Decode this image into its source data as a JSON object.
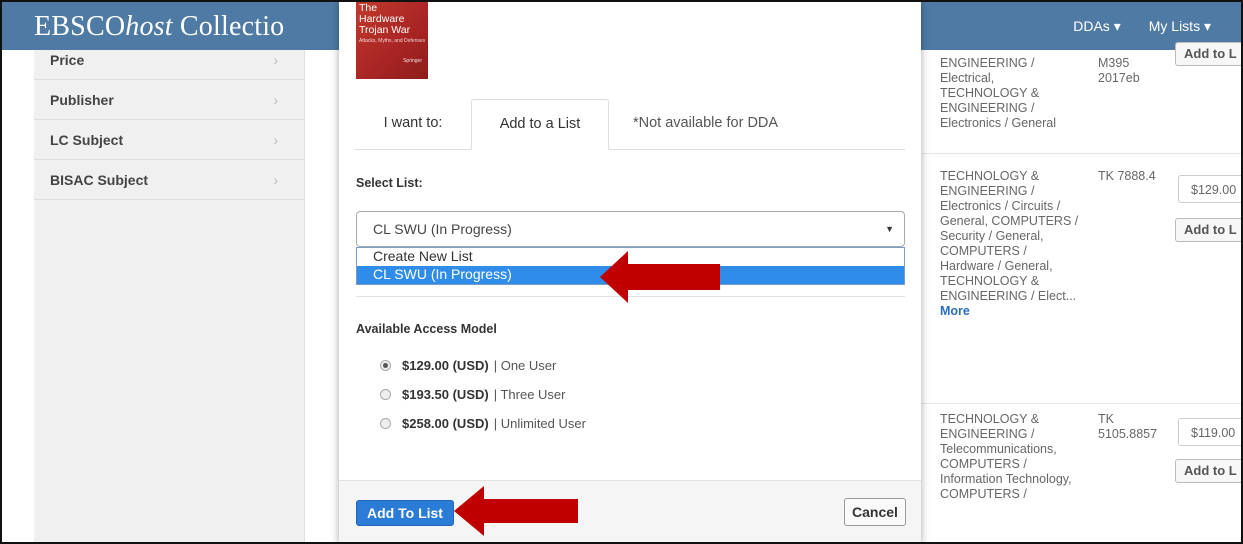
{
  "header": {
    "brand_main": "EBSCO",
    "brand_host": "host",
    "brand_rest": " Collectio",
    "nav": [
      {
        "label": "DDAs ▾"
      },
      {
        "label": "My Lists ▾"
      }
    ]
  },
  "sidebar": {
    "facets": [
      {
        "label": "Price"
      },
      {
        "label": "Publisher"
      },
      {
        "label": "LC Subject"
      },
      {
        "label": "BISAC Subject"
      }
    ],
    "chevron": "›"
  },
  "results": [
    {
      "subject": "ENGINEERING / Electrical, TECHNOLOGY & ENGINEERING / Electronics / General",
      "call_number": "M395 2017eb",
      "add_label": "Add to L"
    },
    {
      "subject_main": "TECHNOLOGY & ENGINEERING / Electronics / Circuits / General, COMPUTERS / Security / General, COMPUTERS / Hardware / General, TECHNOLOGY & ENGINEERING / Elect...",
      "more_label": "More",
      "call_number": "TK 7888.4",
      "price": "$129.00",
      "add_label": "Add to L"
    },
    {
      "subject": "TECHNOLOGY & ENGINEERING / Telecommunications, COMPUTERS / Information Technology, COMPUTERS /",
      "call_number": "TK 5105.8857",
      "price": "$119.00",
      "add_label": "Add to L"
    }
  ],
  "modal": {
    "book_cover": {
      "line1": "The",
      "line2": "Hardware",
      "line3": "Trojan War",
      "subtitle": "Attacks, Myths, and Defenses",
      "publisher_logo": "Springer"
    },
    "tabs": {
      "intro": "I want to:",
      "active": "Add to a List",
      "unavailable": "*Not available for DDA"
    },
    "select_list_label": "Select List:",
    "select_value": "CL SWU (In Progress)",
    "dropdown_options": [
      "Create New List",
      "CL SWU (In Progress)"
    ],
    "selected_option_index": 1,
    "access_model_label": "Available Access Model",
    "access_models": [
      {
        "price": "$129.00 (USD)",
        "desc": "| One User",
        "checked": true
      },
      {
        "price": "$193.50 (USD)",
        "desc": "| Three User",
        "checked": false
      },
      {
        "price": "$258.00 (USD)",
        "desc": "| Unlimited User",
        "checked": false
      }
    ],
    "primary_button": "Add To List",
    "cancel_button": "Cancel"
  },
  "annotations": {
    "arrow_color": "#c00000"
  }
}
